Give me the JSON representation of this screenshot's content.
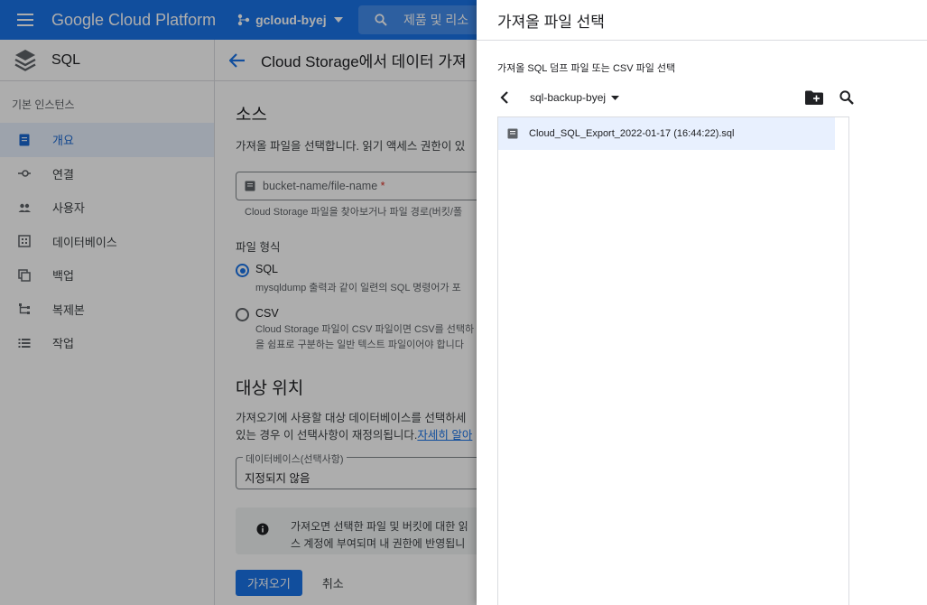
{
  "topbar": {
    "product": "Google Cloud Platform",
    "project": "gcloud-byej",
    "search_placeholder": "제품 및 리소"
  },
  "sidenav": {
    "title": "SQL",
    "section": "기본 인스턴스",
    "items": [
      {
        "label": "개요",
        "icon": "overview-icon"
      },
      {
        "label": "연결",
        "icon": "connections-icon"
      },
      {
        "label": "사용자",
        "icon": "users-icon"
      },
      {
        "label": "데이터베이스",
        "icon": "databases-icon"
      },
      {
        "label": "백업",
        "icon": "backups-icon"
      },
      {
        "label": "복제본",
        "icon": "replicas-icon"
      },
      {
        "label": "작업",
        "icon": "operations-icon"
      }
    ]
  },
  "main": {
    "page_title": "Cloud Storage에서 데이터 가져",
    "source_heading": "소스",
    "source_desc": "가져올 파일을 선택합니다. 읽기 액세스 권한이 있",
    "file_placeholder": "bucket-name/file-name",
    "file_required": "*",
    "file_hint": "Cloud Storage 파일을 찾아보거나 파일 경로(버킷/폴",
    "format_label": "파일 형식",
    "format_options": [
      {
        "label": "SQL",
        "desc": "mysqldump 출력과 같이 일련의 SQL 명령어가 포",
        "selected": true
      },
      {
        "label": "CSV",
        "desc": "Cloud Storage 파일이 CSV 파일이면 CSV를 선택하",
        "desc2": "을 쉼표로 구분하는 일반 텍스트 파일이어야 합니다",
        "selected": false
      }
    ],
    "dest_heading": "대상 위치",
    "dest_desc_line1": "가져오기에 사용할 대상 데이터베이스를 선택하세",
    "dest_desc_line2": "있는 경우 이 선택사항이 재정의됩니다.",
    "dest_link": "자세히 알아",
    "db_label": "데이터베이스(선택사항)",
    "db_value": "지정되지 않음",
    "info_line1": "가져오면 선택한 파일 및 버킷에 대한 읽",
    "info_line2": "스 계정에 부여되며 내 권한에 반영됩니",
    "import_button": "가져오기",
    "cancel_button": "취소"
  },
  "panel": {
    "title": "가져올 파일 선택",
    "subtitle": "가져올 SQL 덤프 파일 또는 CSV 파일 선택",
    "bucket": "sql-backup-byej",
    "files": [
      {
        "name": "Cloud_SQL_Export_2022-01-17 (16:44:22).sql",
        "selected": true
      }
    ]
  },
  "colors": {
    "brand": "#1a73e8",
    "nav_active_bg": "#e8f0fe",
    "selected_row": "#e8f0fe"
  }
}
